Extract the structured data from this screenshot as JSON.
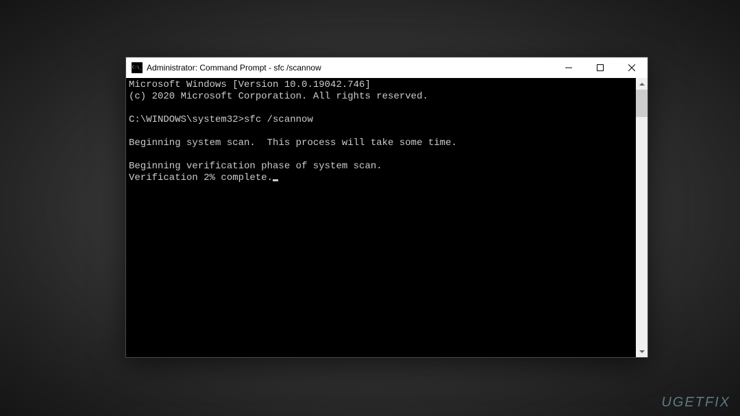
{
  "window": {
    "title": "Administrator: Command Prompt - sfc  /scannow"
  },
  "console": {
    "lines": [
      "Microsoft Windows [Version 10.0.19042.746]",
      "(c) 2020 Microsoft Corporation. All rights reserved.",
      "",
      "C:\\WINDOWS\\system32>sfc /scannow",
      "",
      "Beginning system scan.  This process will take some time.",
      "",
      "Beginning verification phase of system scan.",
      "Verification 2% complete."
    ]
  },
  "watermark": {
    "text": "UGETFIX"
  }
}
